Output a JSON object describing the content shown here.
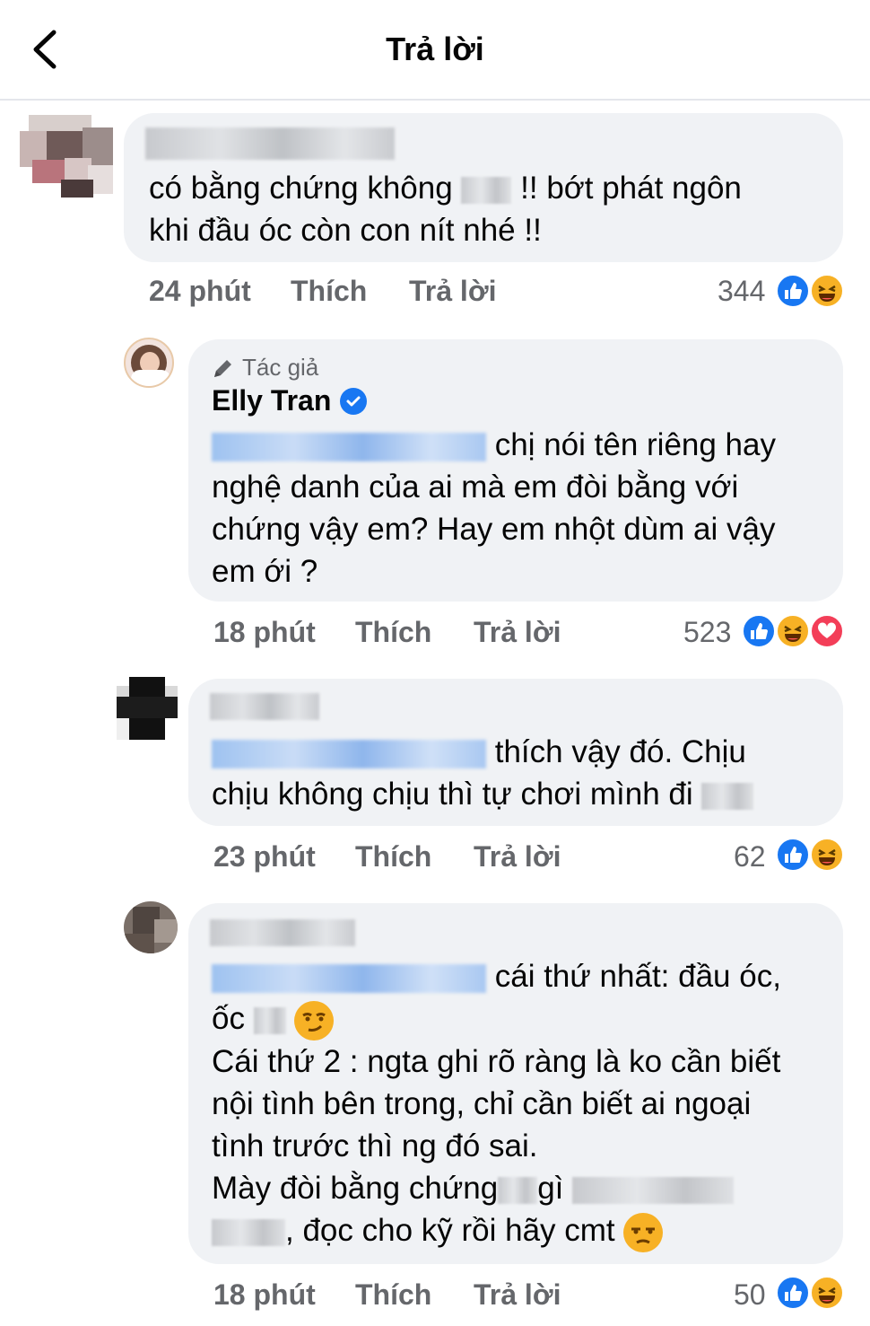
{
  "header": {
    "title": "Trả lời"
  },
  "comments": [
    {
      "text_a": "có bằng chứng không",
      "text_b": "!! bớt phát ngôn",
      "text_c": "khi đầu óc còn con nít nhé !!",
      "time": "24 phút",
      "like": "Thích",
      "reply": "Trả lời",
      "count": "344",
      "reactions": [
        "like-icon",
        "haha-icon"
      ]
    },
    {
      "author_tag": "Tác giả",
      "author": "Elly Tran",
      "text_a": "chị nói tên riêng hay",
      "text_b": "nghệ danh của ai mà em đòi bằng với",
      "text_c": "chứng vậy em? Hay em nhột dùm ai vậy",
      "text_d": "em ới ?",
      "time": "18 phút",
      "like": "Thích",
      "reply": "Trả lời",
      "count": "523",
      "reactions": [
        "like-icon",
        "haha-icon",
        "love-icon"
      ]
    },
    {
      "text_a": "thích vậy đó. Chịu",
      "text_b": "chịu không chịu thì tự chơi mình đi",
      "time": "23 phút",
      "like": "Thích",
      "reply": "Trả lời",
      "count": "62",
      "reactions": [
        "like-icon",
        "haha-icon"
      ]
    },
    {
      "text_a": "cái thứ nhất: đầu óc,",
      "text_b": "ốc",
      "text_c": "Cái thứ 2 : ngta ghi rõ ràng là ko cần biết",
      "text_d": "nội tình bên trong, chỉ cần biết ai ngoại",
      "text_e": "tình trước thì ng đó sai.",
      "text_f1": "Mày đòi bằng chứng",
      "text_f2": "gì",
      "text_g": ", đọc cho kỹ rồi hãy cmt",
      "time": "18 phút",
      "like": "Thích",
      "reply": "Trả lời",
      "count": "50",
      "reactions": [
        "like-icon",
        "haha-icon"
      ]
    }
  ],
  "colors": {
    "like": "#1877f2",
    "haha": "#f7b125",
    "love": "#f33e58",
    "bubble": "#f0f2f5",
    "meta": "#65676b"
  }
}
